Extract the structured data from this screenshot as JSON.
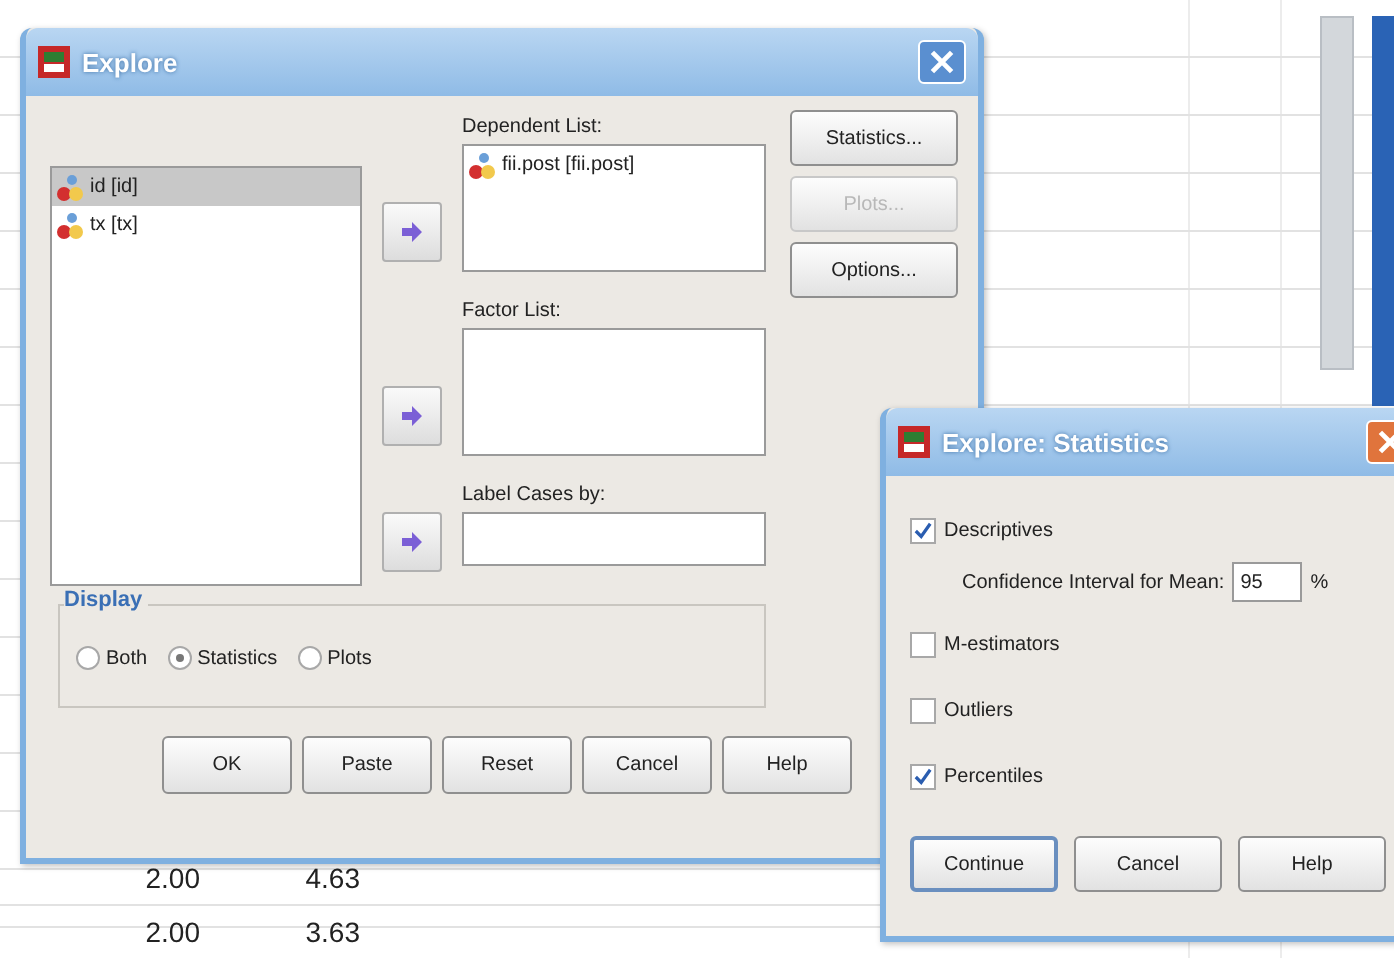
{
  "spreadsheet": {
    "rows": [
      [
        "2.00",
        "4.63"
      ],
      [
        "2.00",
        "3.63"
      ]
    ]
  },
  "explore": {
    "title": "Explore",
    "variables": [
      {
        "label": "id [id]",
        "selected": true
      },
      {
        "label": "tx [tx]",
        "selected": false
      }
    ],
    "dependent_list": {
      "label": "Dependent List:",
      "items": [
        "fii.post [fii.post]"
      ]
    },
    "factor_list": {
      "label": "Factor List:"
    },
    "label_cases": {
      "label": "Label Cases by:"
    },
    "side_buttons": [
      {
        "label": "Statistics...",
        "disabled": false
      },
      {
        "label": "Plots...",
        "disabled": true
      },
      {
        "label": "Options...",
        "disabled": false
      }
    ],
    "display": {
      "title": "Display",
      "options": [
        {
          "label": "Both",
          "selected": false
        },
        {
          "label": "Statistics",
          "selected": true
        },
        {
          "label": "Plots",
          "selected": false
        }
      ]
    },
    "buttons": [
      "OK",
      "Paste",
      "Reset",
      "Cancel",
      "Help"
    ]
  },
  "statistics": {
    "title": "Explore: Statistics",
    "options": [
      {
        "label": "Descriptives",
        "checked": true
      },
      {
        "label": "M-estimators",
        "checked": false
      },
      {
        "label": "Outliers",
        "checked": false
      },
      {
        "label": "Percentiles",
        "checked": true
      }
    ],
    "confidence": {
      "label": "Confidence Interval for Mean:",
      "value": "95",
      "unit": "%"
    },
    "buttons": [
      "Continue",
      "Cancel",
      "Help"
    ]
  }
}
